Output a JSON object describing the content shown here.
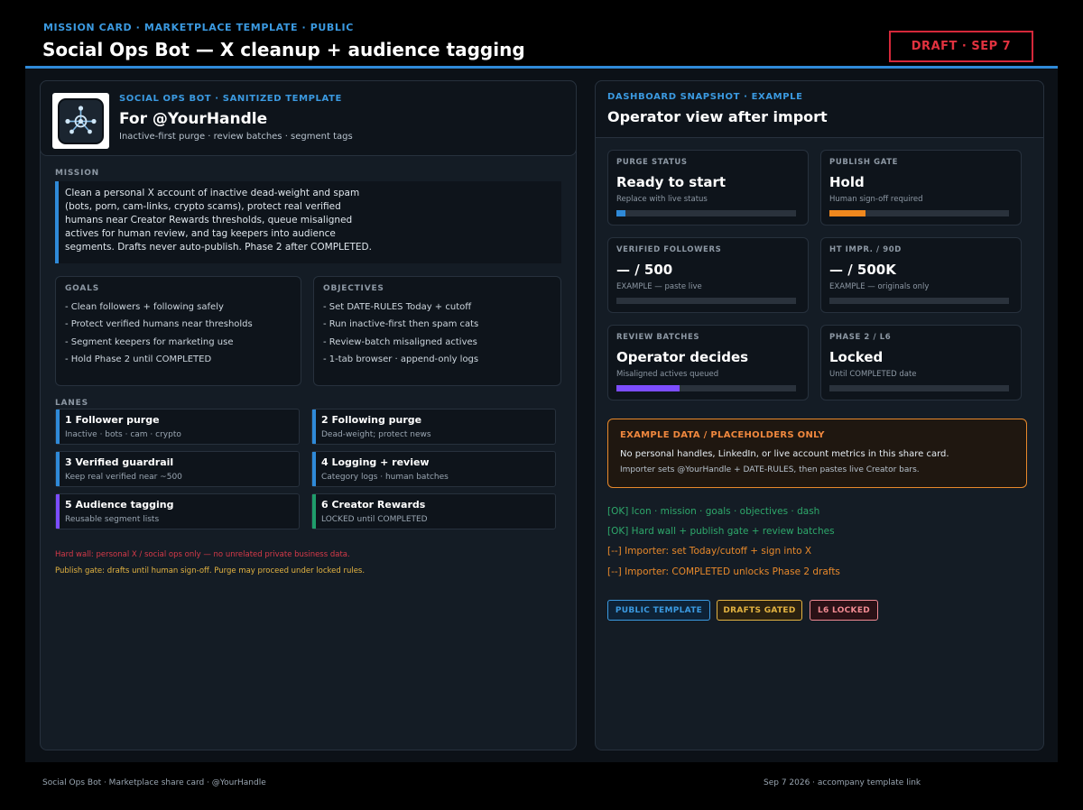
{
  "header": {
    "kicker": "MISSION CARD · MARKETPLACE TEMPLATE · PUBLIC",
    "title": "Social Ops Bot — X cleanup + audience tagging",
    "draft_badge": "DRAFT · SEP 7"
  },
  "identity": {
    "kicker": "SOCIAL OPS BOT · SANITIZED TEMPLATE",
    "title": "For @YourHandle",
    "subtitle": "Inactive-first purge · review batches · segment tags",
    "logo_icon": "network-node-icon"
  },
  "mission": {
    "label": "MISSION",
    "text": "Clean a personal X account of inactive dead-weight and spam (bots, porn, cam-links, crypto scams), protect real verified humans near Creator Rewards thresholds, queue misaligned actives for human review, and tag keepers into audience segments. Drafts never auto-publish. Phase 2 after COMPLETED."
  },
  "goals": {
    "label": "GOALS",
    "items": [
      "- Clean followers + following safely",
      "- Protect verified humans near thresholds",
      "- Segment keepers for marketing use",
      "- Hold Phase 2 until COMPLETED"
    ]
  },
  "objectives": {
    "label": "OBJECTIVES",
    "items": [
      "- Set DATE-RULES Today + cutoff",
      "- Run inactive-first then spam cats",
      "- Review-batch misaligned actives",
      "- 1-tab browser · append-only logs"
    ]
  },
  "lanes": {
    "label": "LANES",
    "items": [
      {
        "title": "1 Follower purge",
        "sub": "Inactive · bots · cam · crypto",
        "color": "#2f8ad8"
      },
      {
        "title": "2 Following purge",
        "sub": "Dead-weight; protect news",
        "color": "#2f8ad8"
      },
      {
        "title": "3 Verified guardrail",
        "sub": "Keep real verified near ~500",
        "color": "#2f8ad8"
      },
      {
        "title": "4 Logging + review",
        "sub": "Category logs · human batches",
        "color": "#2f8ad8"
      },
      {
        "title": "5 Audience tagging",
        "sub": "Reusable segment lists",
        "color": "#7c4dff"
      },
      {
        "title": "6 Creator Rewards",
        "sub": "LOCKED until COMPLETED",
        "color": "#1f9d6b"
      }
    ]
  },
  "notes": {
    "hard_wall": "Hard wall: personal X / social ops only — no unrelated private business data.",
    "publish_gate": "Publish gate: drafts until human sign-off. Purge may proceed under locked rules."
  },
  "dashboard": {
    "kicker": "DASHBOARD SNAPSHOT · EXAMPLE",
    "title": "Operator view after import",
    "metrics": [
      {
        "label": "PURGE STATUS",
        "value": "Ready to start",
        "note": "Replace with live status",
        "progress": 0.05,
        "color": "#2f8ad8"
      },
      {
        "label": "PUBLISH GATE",
        "value": "Hold",
        "note": "Human sign-off required",
        "progress": 0.2,
        "color": "#f0881e"
      },
      {
        "label": "VERIFIED FOLLOWERS",
        "value": "— / 500",
        "note": "EXAMPLE — paste live",
        "progress": 0,
        "color": "#2f8ad8"
      },
      {
        "label": "HT IMPR. / 90D",
        "value": "— / 500K",
        "note": "EXAMPLE — originals only",
        "progress": 0,
        "color": "#2f8ad8"
      },
      {
        "label": "REVIEW BATCHES",
        "value": "Operator decides",
        "note": "Misaligned actives queued",
        "progress": 0.35,
        "color": "#7c4dff"
      },
      {
        "label": "PHASE 2 / L6",
        "value": "Locked",
        "note": "Until COMPLETED date",
        "progress": 0,
        "color": "#2f8ad8"
      }
    ]
  },
  "warning": {
    "title": "EXAMPLE DATA / PLACEHOLDERS ONLY",
    "body": "No personal handles, LinkedIn, or live account metrics in this share card.",
    "sub": "Importer sets @YourHandle + DATE-RULES, then pastes live Creator bars."
  },
  "checklist": [
    {
      "text": "[OK]  Icon · mission · goals · objectives · dash",
      "color": "#2ea86b"
    },
    {
      "text": "[OK]  Hard wall + publish gate + review batches",
      "color": "#2ea86b"
    },
    {
      "text": "[--]  Importer: set Today/cutoff + sign into X",
      "color": "#e8892b"
    },
    {
      "text": "[--]  Importer: COMPLETED unlocks Phase 2 drafts",
      "color": "#e8892b"
    }
  ],
  "tags": [
    {
      "label": "PUBLIC TEMPLATE",
      "color": "#3b9ae1",
      "bg": "#0e2236"
    },
    {
      "label": "DRAFTS GATED",
      "color": "#e3b341",
      "bg": "#2a2110"
    },
    {
      "label": "L6 LOCKED",
      "color": "#f08a92",
      "bg": "#2a1116"
    }
  ],
  "footer": {
    "left": "Social Ops Bot · Marketplace share card · @YourHandle",
    "right": "Sep 7 2026 · accompany template link"
  }
}
